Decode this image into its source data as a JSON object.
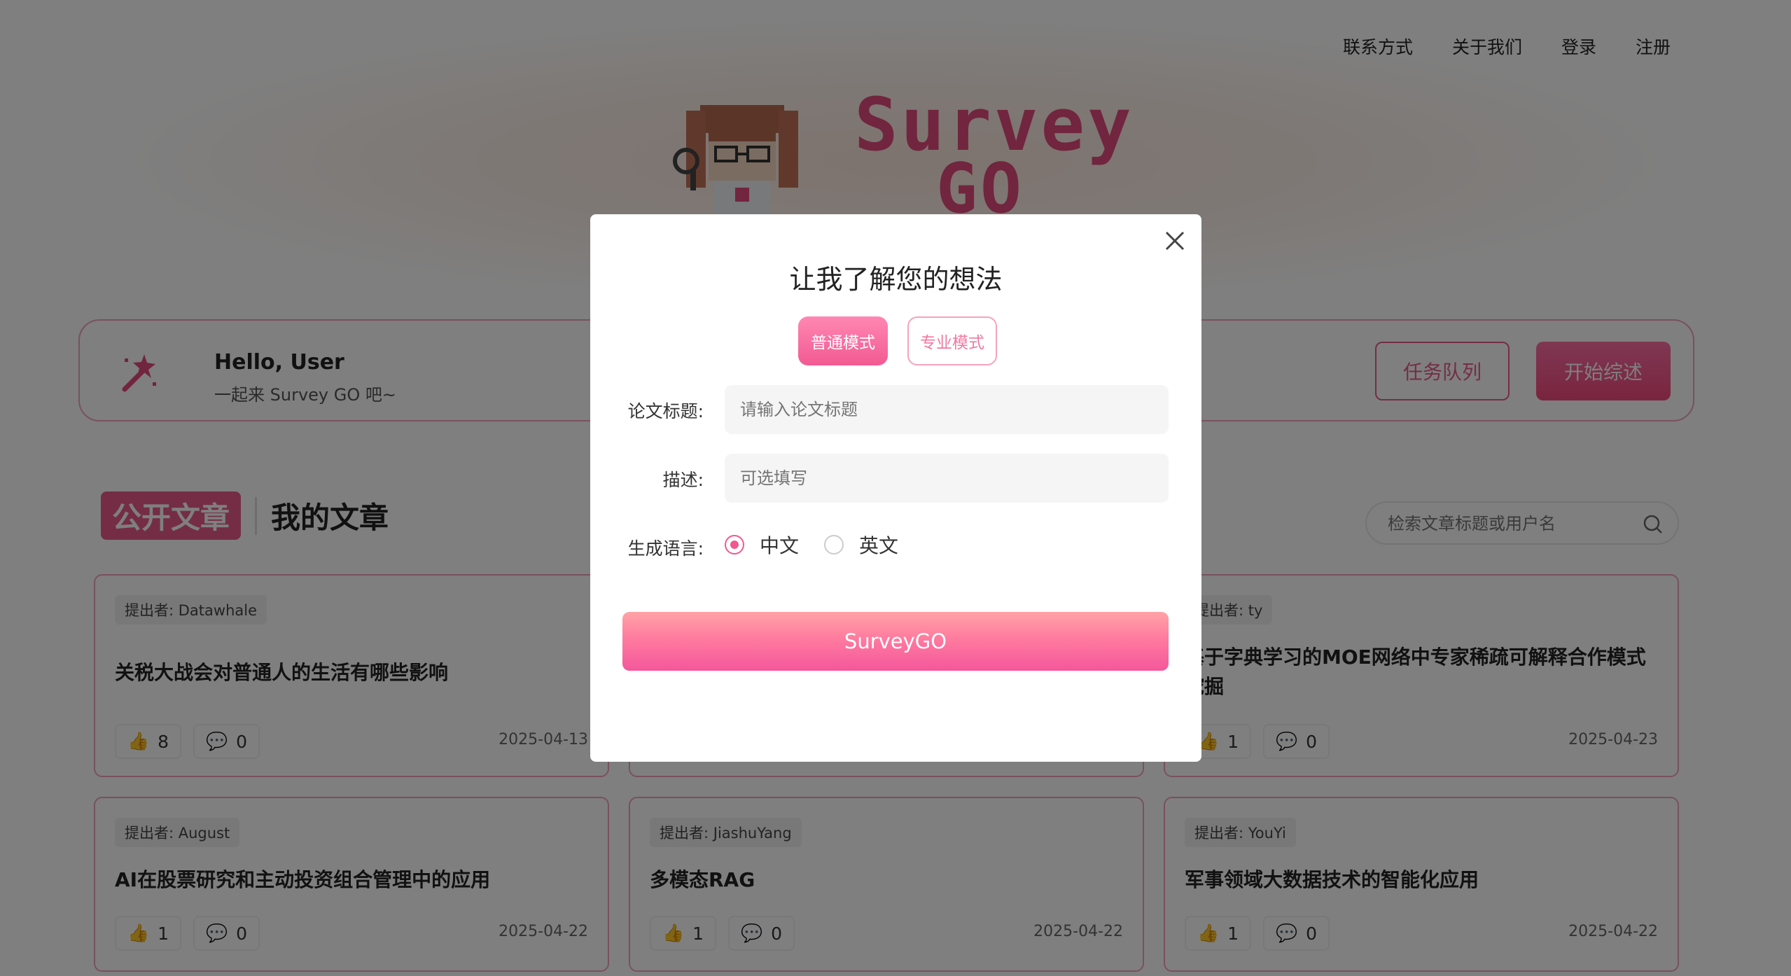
{
  "nav": {
    "contact": "联系方式",
    "about": "关于我们",
    "login": "登录",
    "register": "注册"
  },
  "logo": {
    "line1": "Survey",
    "line2": "GO"
  },
  "hello": {
    "title": "Hello, User",
    "subtitle": "一起来 Survey GO 吧~",
    "queue_button": "任务队列",
    "start_button": "开始综述"
  },
  "tabs": {
    "public": "公开文章",
    "mine": "我的文章"
  },
  "search": {
    "placeholder": "检索文章标题或用户名"
  },
  "articles": [
    {
      "by": "提出者: Datawhale",
      "title": "关税大战会对普通人的生活有哪些影响",
      "likes": "8",
      "comments": "0",
      "date": "2025-04-13"
    },
    {
      "by": "提出者: ty",
      "title_line1": "基于字典学习的MOE网络中专家稀疏可解释合作模式",
      "title_line2": "挖掘",
      "likes": "1",
      "comments": "0",
      "date": "2025-04-23"
    },
    {
      "by": "提出者: August",
      "title": "AI在股票研究和主动投资组合管理中的应用",
      "likes": "1",
      "comments": "0",
      "date": "2025-04-22"
    },
    {
      "by": "提出者: JiashuYang",
      "title": "多模态RAG",
      "likes": "1",
      "comments": "0",
      "date": "2025-04-22"
    },
    {
      "by": "提出者: YouYi",
      "title": "军事领域大数据技术的智能化应用",
      "likes": "1",
      "comments": "0",
      "date": "2025-04-22"
    }
  ],
  "modal": {
    "title": "让我了解您的想法",
    "mode_normal": "普通模式",
    "mode_pro": "专业模式",
    "paper_title_label": "论文标题:",
    "paper_title_placeholder": "请输入论文标题",
    "desc_label": "描述:",
    "desc_placeholder": "可选填写",
    "lang_label": "生成语言:",
    "lang_zh": "中文",
    "lang_en": "英文",
    "submit": "SurveyGO"
  },
  "colors": {
    "accent": "#f2588f",
    "card_border": "#f2a3bd",
    "overlay": "rgba(0,0,0,0.5)"
  }
}
